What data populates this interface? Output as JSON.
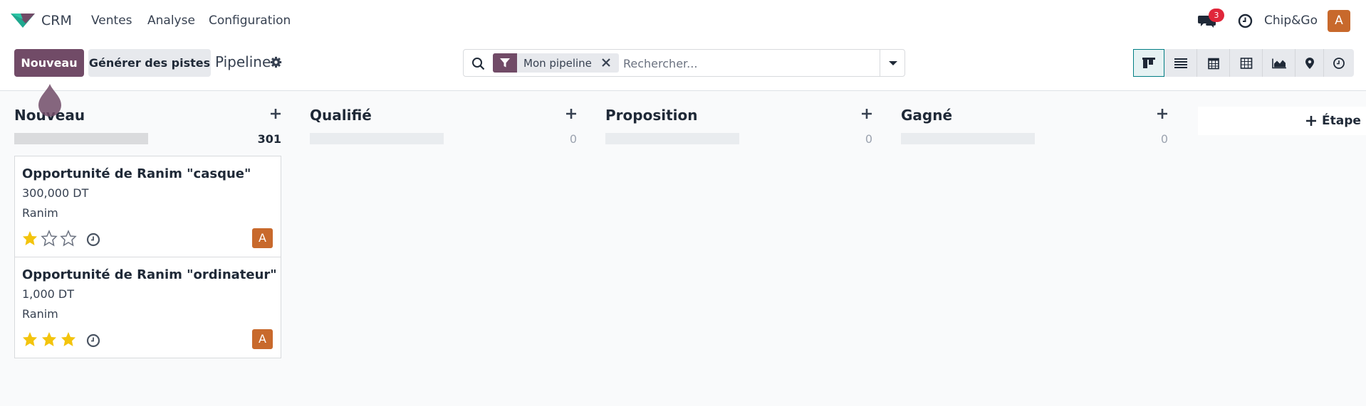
{
  "navbar": {
    "app_name": "CRM",
    "menus": [
      "Ventes",
      "Analyse",
      "Configuration"
    ],
    "chat_badge": "3",
    "company": "Chip&Go",
    "user_initial": "A",
    "brand_color": "#714b67",
    "avatar_color": "#c8692c"
  },
  "control": {
    "new_label": "Nouveau",
    "generate_label": "Générer des pistes",
    "breadcrumb": "Pipeline",
    "search_facet": "Mon pipeline",
    "search_placeholder": "Rechercher...",
    "views": [
      "kanban-icon",
      "list-icon",
      "calendar-icon",
      "pivot-icon",
      "graph-icon",
      "map-icon",
      "activity-icon"
    ],
    "active_view": "kanban-icon"
  },
  "columns": [
    {
      "title": "Nouveau",
      "count": "301"
    },
    {
      "title": "Qualifié",
      "count": "0"
    },
    {
      "title": "Proposition",
      "count": "0"
    },
    {
      "title": "Gagné",
      "count": "0"
    }
  ],
  "cards": [
    {
      "title": "Opportunité de Ranim \"casque\"",
      "amount": "300,000 DT",
      "contact": "Ranim",
      "stars_filled": 1,
      "avatar": "A"
    },
    {
      "title": "Opportunité de Ranim \"ordinateur\"",
      "amount": "1,000 DT",
      "contact": "Ranim",
      "stars_filled": 3,
      "avatar": "A"
    }
  ],
  "add_stage_label": "Étape"
}
